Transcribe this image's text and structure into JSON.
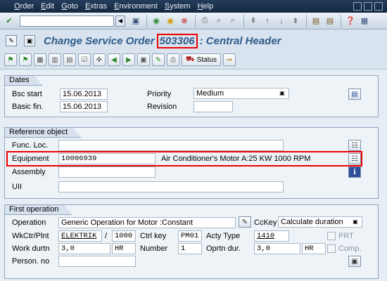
{
  "menu": [
    "Order",
    "Edit",
    "Goto",
    "Extras",
    "Environment",
    "System",
    "Help"
  ],
  "title": {
    "prefix": "Change Service Order",
    "order_number": "503306",
    "suffix": ": Central Header"
  },
  "app_toolbar": {
    "status_label": "Status"
  },
  "dates": {
    "group_title": "Dates",
    "bsc_start_label": "Bsc start",
    "bsc_start_value": "15.06.2013",
    "basic_fin_label": "Basic fin.",
    "basic_fin_value": "15.06.2013",
    "priority_label": "Priority",
    "priority_value": "Medium",
    "revision_label": "Revision",
    "revision_value": ""
  },
  "reference": {
    "group_title": "Reference object",
    "func_loc_label": "Func. Loc.",
    "equipment_label": "Equipment",
    "equipment_value": "10006939",
    "equipment_desc": "Air Conditioner's Motor A:25 KW 1000 RPM",
    "assembly_label": "Assembly",
    "uii_label": "UII"
  },
  "operation": {
    "group_title": "First operation",
    "operation_label": "Operation",
    "operation_value": "Generic Operation for Motor :Constant",
    "ckey_label": "CcKey",
    "ckey_value": "Calculate duration",
    "wkctr_label": "WkCtr/Plnt",
    "wkctr_value": "ELEKTRIK",
    "plant_sep": "/",
    "plant_value": "1000",
    "ctrl_key_label": "Ctrl key",
    "ctrl_key_value": "PM01",
    "acty_type_label": "Acty Type",
    "acty_type_value": "1410",
    "prt_label": "PRT",
    "work_label": "Work durtn",
    "work_value": "3,0",
    "work_unit": "HR",
    "number_label": "Number",
    "number_value": "1",
    "oprtn_dur_label": "Oprtn dur.",
    "oprtn_dur_value": "3,0",
    "oprtn_dur_unit": "HR",
    "comp_label": "Comp.",
    "person_label": "Person. no"
  }
}
